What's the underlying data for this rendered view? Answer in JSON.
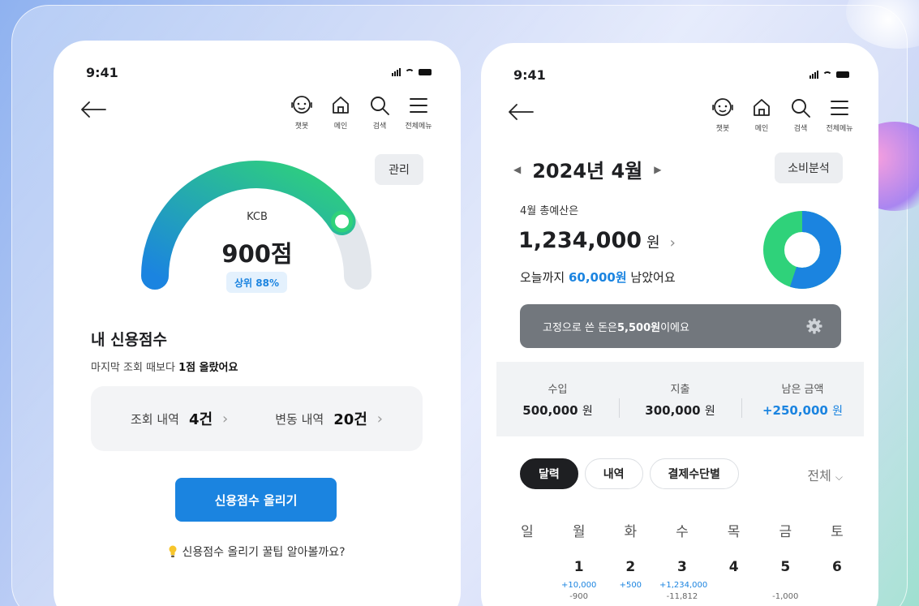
{
  "colors": {
    "accent": "#1b84e0",
    "gauge_start": "#1b84e0",
    "gauge_end": "#2fd27a",
    "donut_blue": "#1b84e0",
    "donut_green": "#2fd27a",
    "dark": "#1e1f22"
  },
  "credit_screen": {
    "time": "9:41",
    "nav": [
      {
        "icon": "chatbot-icon",
        "label": "챗봇"
      },
      {
        "icon": "home-icon",
        "label": "메인"
      },
      {
        "icon": "search-icon",
        "label": "검색"
      },
      {
        "icon": "menu-icon",
        "label": "전체메뉴"
      }
    ],
    "manage_label": "관리",
    "gauge": {
      "provider": "KCB",
      "score": "900점",
      "rank": "상위 88%",
      "fill_fraction": 0.82
    },
    "section_title": "내 신용점수",
    "change_prefix": "마지막 조회 때보다 ",
    "change_value": "1점 올랐어요",
    "inquiry_label": "조회 내역",
    "inquiry_count": "4건",
    "change_label": "변동 내역",
    "change_count": "20건",
    "primary_button": "신용점수 올리기",
    "tip_text": "신용점수 올리기 꿀팁 알아볼까요?"
  },
  "budget_screen": {
    "time": "9:41",
    "nav": [
      {
        "icon": "chatbot-icon",
        "label": "챗봇"
      },
      {
        "icon": "home-icon",
        "label": "메인"
      },
      {
        "icon": "search-icon",
        "label": "검색"
      },
      {
        "icon": "menu-icon",
        "label": "전체메뉴"
      }
    ],
    "month": "2024년 4월",
    "analyze_label": "소비분석",
    "budget_label": "4월 총예산은",
    "budget_amount": "1,234,000",
    "budget_unit": "원",
    "remain_prefix": "오늘까지 ",
    "remain_amount": "60,000원",
    "remain_suffix": " 남았어요",
    "donut": {
      "used_fraction": 0.55
    },
    "fixed_prefix": "고정으로 쓴 돈은 ",
    "fixed_amount": "5,500원",
    "fixed_suffix": " 이에요",
    "summary": [
      {
        "label": "수입",
        "value": "500,000",
        "unit": "원"
      },
      {
        "label": "지출",
        "value": "300,000",
        "unit": "원"
      },
      {
        "label": "남은 금액",
        "value": "+250,000",
        "unit": "원"
      }
    ],
    "tabs": [
      "달력",
      "내역",
      "결제수단별"
    ],
    "filter_label": "전체",
    "weekdays": [
      "일",
      "월",
      "화",
      "수",
      "목",
      "금",
      "토"
    ],
    "days": [
      {
        "num": "",
        "inc": "",
        "exp": ""
      },
      {
        "num": "1",
        "inc": "+10,000",
        "exp": "-900"
      },
      {
        "num": "2",
        "inc": "+500",
        "exp": ""
      },
      {
        "num": "3",
        "inc": "+1,234,000",
        "exp": "-11,812"
      },
      {
        "num": "4",
        "inc": "",
        "exp": ""
      },
      {
        "num": "5",
        "inc": "",
        "exp": "-1,000"
      },
      {
        "num": "6",
        "inc": "",
        "exp": ""
      }
    ]
  }
}
